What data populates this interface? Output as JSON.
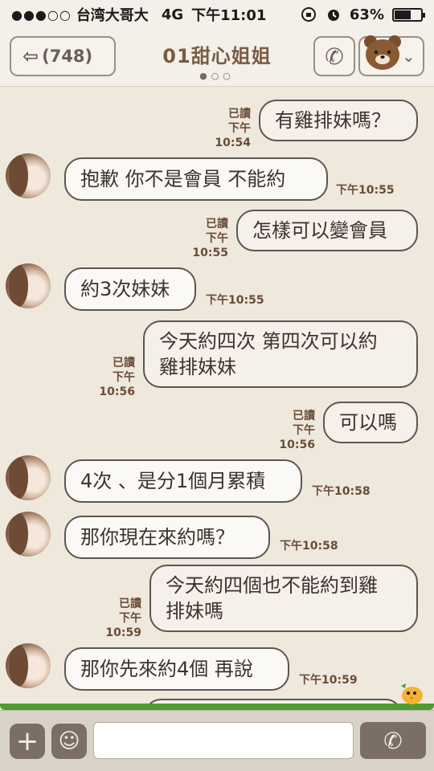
{
  "status_bar": {
    "signal": "●●●○○",
    "carrier": "台湾大哥大",
    "network": "4G",
    "time": "下午11:01",
    "battery": "63%",
    "battery_level": 0.63
  },
  "header": {
    "back_count": "(748)",
    "title": "01甜心姐姐",
    "page_dots": "●○○"
  },
  "messages": [
    {
      "side": "out",
      "text": "有雞排妹嗎？",
      "read": "已讀",
      "time": "下午10:54"
    },
    {
      "side": "in",
      "text": "抱歉 你不是會員 不能約",
      "time": "下午10:55"
    },
    {
      "side": "out",
      "text": "怎樣可以變會員",
      "read": "已讀",
      "time": "下午10:55"
    },
    {
      "side": "in",
      "text": "約3次妹妹",
      "time": "下午10:55"
    },
    {
      "side": "out",
      "text_line1": "今天約四次 第四次可以約",
      "text_line2": "雞排妹妹",
      "read": "已讀",
      "time": "下午10:56"
    },
    {
      "side": "out",
      "text": "可以嗎",
      "read": "已讀",
      "time": "下午10:56"
    },
    {
      "side": "in",
      "text": "4次 、是分1個月累積",
      "time": "下午10:58"
    },
    {
      "side": "in",
      "text": "那你現在來約嗎？",
      "time": "下午10:58"
    },
    {
      "side": "out",
      "text_line1": "今天約四個也不能約到雞",
      "text_line2": "排妹嗎",
      "read": "已讀",
      "time": "下午10:59"
    },
    {
      "side": "in",
      "text": "那你先來約4個 再說",
      "time": "下午10:59"
    }
  ],
  "input": {
    "value": "",
    "plus_icon": "plus-icon",
    "sticker_icon": "sticker-icon",
    "send_icon": "phone-icon"
  },
  "colors": {
    "background": "#efe8dd",
    "bubble_border": "#5e5550",
    "title": "#7a5c42",
    "grass": "#4e9c30"
  }
}
